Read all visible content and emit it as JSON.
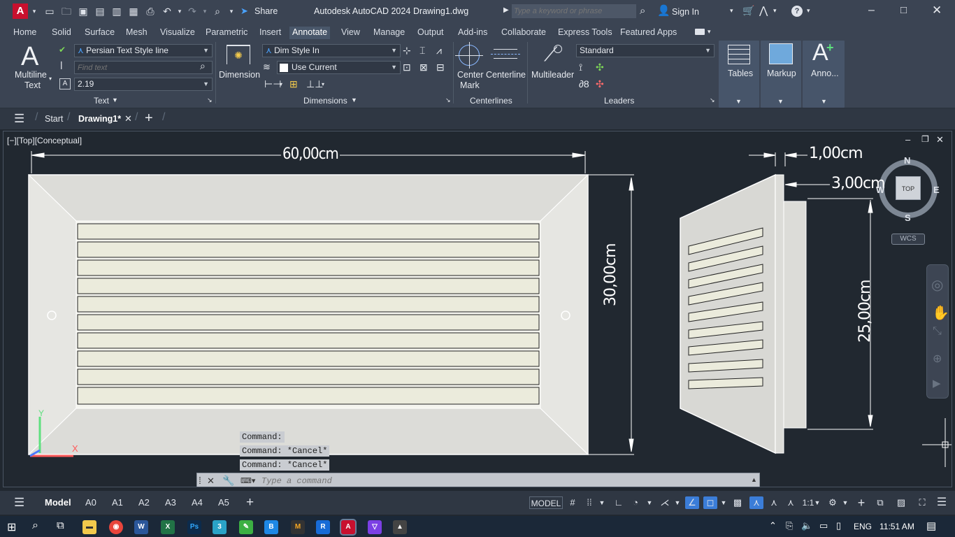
{
  "app": {
    "logo": "A",
    "title": "Autodesk AutoCAD 2024",
    "file": "Drawing1.dwg",
    "share": "Share",
    "search_placeholder": "Type a keyword or phrase",
    "signin": "Sign In",
    "help": "?"
  },
  "ribbon_tabs": [
    "Home",
    "Solid",
    "Surface",
    "Mesh",
    "Visualize",
    "Parametric",
    "Insert",
    "Annotate",
    "View",
    "Manage",
    "Output",
    "Add-ins",
    "Collaborate",
    "Express Tools",
    "Featured Apps"
  ],
  "active_tab": "Annotate",
  "text_panel": {
    "multiline_line1": "Multiline",
    "multiline_line2": "Text",
    "style": "Persian Text Style line",
    "find_placeholder": "Find text",
    "height": "2.19",
    "label": "Text"
  },
  "dim_panel": {
    "dimension": "Dimension",
    "dim_style": "Dim Style In",
    "layer": "Use Current",
    "label": "Dimensions"
  },
  "centerlines_panel": {
    "center_mark_1": "Center",
    "center_mark_2": "Mark",
    "centerline": "Centerline",
    "label": "Centerlines"
  },
  "leaders_panel": {
    "multileader": "Multileader",
    "style": "Standard",
    "label": "Leaders"
  },
  "big_buttons": {
    "tables": "Tables",
    "markup": "Markup",
    "anno": "Anno..."
  },
  "doc_tabs": {
    "start": "Start",
    "drawing": "Drawing1*"
  },
  "viewport": {
    "label": "[−][Top][Conceptual]",
    "dim_width": "60,00cm",
    "dim_height": "30,00cm",
    "dim_depth": "1,00cm",
    "dim_frame": "3,00cm",
    "dim_side": "25,00cm",
    "compass_n": "N",
    "compass_s": "S",
    "compass_e": "E",
    "compass_w": "W",
    "cube_top": "TOP",
    "wcs": "WCS",
    "axis_y": "Y",
    "axis_x": "X"
  },
  "command_history": [
    "Command:",
    "Command: *Cancel*",
    "Command: *Cancel*"
  ],
  "command_placeholder": "Type a command",
  "layout_tabs": [
    "Model",
    "A0",
    "A1",
    "A2",
    "A3",
    "A4",
    "A5"
  ],
  "status": {
    "model": "MODEL",
    "scale": "1:1"
  },
  "taskbar": {
    "lang": "ENG",
    "time": "11:51 AM"
  }
}
